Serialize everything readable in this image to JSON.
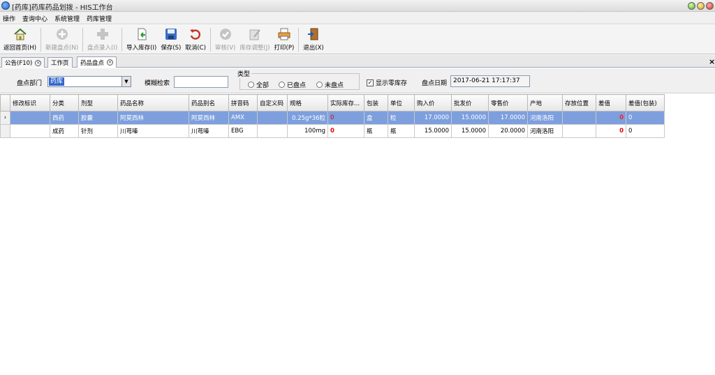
{
  "window": {
    "title": "[药库]药库药品划拨 - HIS工作台"
  },
  "menu": [
    "操作",
    "查询中心",
    "系统管理",
    "药库管理"
  ],
  "toolbar": [
    {
      "label": "返回首页(H)",
      "icon": "home-icon",
      "enabled": true
    },
    {
      "label": "新建盘点(N)",
      "icon": "add-icon",
      "enabled": false
    },
    {
      "label": "盘点录入(I)",
      "icon": "plus-icon",
      "enabled": false
    },
    {
      "label": "导入库存(I)",
      "icon": "import-icon",
      "enabled": true
    },
    {
      "label": "保存(S)",
      "icon": "save-icon",
      "enabled": true
    },
    {
      "label": "取消(C)",
      "icon": "undo-icon",
      "enabled": true
    },
    {
      "label": "审核(V)",
      "icon": "check-icon",
      "enabled": false
    },
    {
      "label": "库存调整(J)",
      "icon": "edit-icon",
      "enabled": false
    },
    {
      "label": "打印(P)",
      "icon": "print-icon",
      "enabled": true
    },
    {
      "label": "退出(X)",
      "icon": "exit-icon",
      "enabled": true
    }
  ],
  "tabs": [
    {
      "label": "公告(F10)"
    },
    {
      "label": "工作页"
    },
    {
      "label": "药品盘点"
    }
  ],
  "filter": {
    "dept_label": "盘点部门",
    "dept_value": "药库",
    "search_label": "模糊检索",
    "search_value": "",
    "type_label": "类型",
    "type_options": [
      "全部",
      "已盘点",
      "未盘点"
    ],
    "show_stock_label": "显示零库存",
    "show_stock_checked": true,
    "date_label": "盘点日期",
    "date_value": "2017-06-21 17:17:37"
  },
  "grid": {
    "columns": [
      "修改标识",
      "分类",
      "剂型",
      "药品名称",
      "药品别名",
      "拼音码",
      "自定义码",
      "规格",
      "实际库存...",
      "包装",
      "单位",
      "购入价",
      "批发价",
      "零售价",
      "产地",
      "存放位置",
      "差值",
      "差值(包装)"
    ],
    "rows": [
      [
        "",
        "西药",
        "胶囊",
        "阿莫西林",
        "阿莫西林",
        "AMX",
        "",
        "0.25g*36粒",
        "0",
        "盒",
        "粒",
        "17.0000",
        "15.0000",
        "17.0000",
        "河南洛阳",
        "",
        "0",
        "0"
      ],
      [
        "",
        "成药",
        "针剂",
        "川芎嗪",
        "川芎嗪",
        "EBG",
        "",
        "100mg",
        "0",
        "瓶",
        "瓶",
        "15.0000",
        "15.0000",
        "20.0000",
        "河南洛阳",
        "",
        "0",
        "0"
      ]
    ]
  },
  "colors": {
    "selected_row": "#7d9fde",
    "zero_value": "#e00000"
  }
}
